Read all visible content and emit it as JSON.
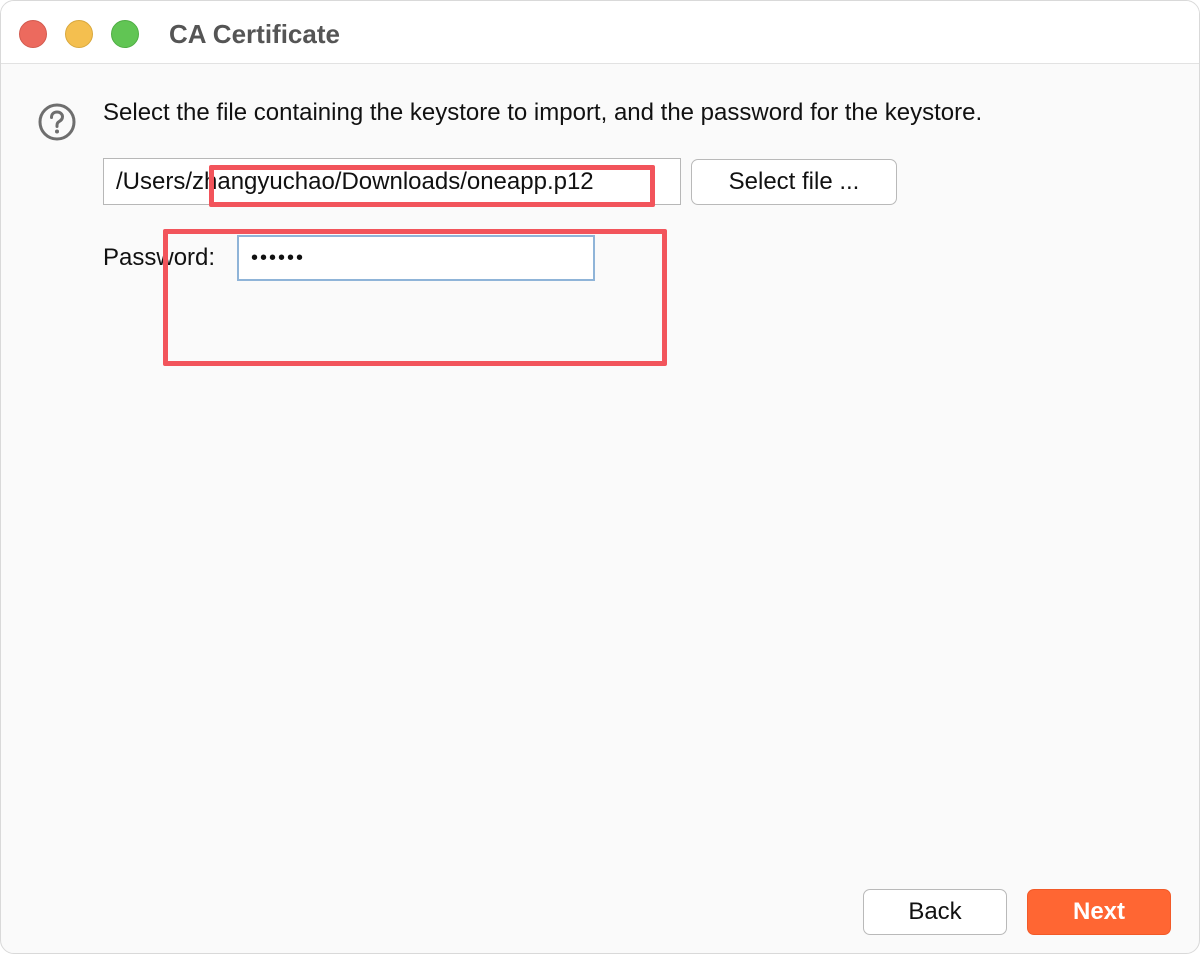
{
  "window": {
    "title": "CA Certificate"
  },
  "dialog": {
    "prompt": "Select the file containing the keystore to import, and the password for the keystore.",
    "file_path": "/Users/zhangyuchao/Downloads/oneapp.p12",
    "select_file_label": "Select file ...",
    "password_label": "Password:",
    "password_value": "••••••"
  },
  "footer": {
    "back_label": "Back",
    "next_label": "Next"
  },
  "colors": {
    "accent": "#ff6633",
    "annotation": "#f2545b",
    "focus_border": "#8fb4d8"
  },
  "icons": {
    "help": "question-circle-icon"
  }
}
